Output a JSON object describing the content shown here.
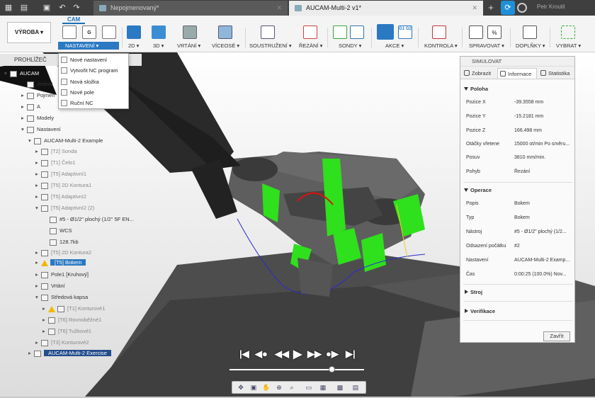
{
  "window": {
    "tab1_title": "Nepojmenovaný*",
    "tab2_title": "AUCAM-Multi-2 v1*",
    "user": "Petr Kroutil"
  },
  "toolbar": {
    "workspace_tab": "CAM",
    "workspace_button": "VÝROBA ▾",
    "groups": [
      "NASTAVENÍ ▾",
      "2D ▾",
      "3D ▾",
      "VRTÁNÍ ▾",
      "VÍCEOSÉ ▾",
      "SOUSTRUŽENÍ ▾",
      "ŘEZÁNÍ ▾",
      "SONDY ▾",
      "AKCE ▾",
      "KONTROLA ▾",
      "SPRAVOVAT ▾",
      "DOPLŇKY ▾",
      "VYBRAT ▾"
    ]
  },
  "browser": {
    "title": "PROHLÍŽEČ",
    "rows": [
      {
        "label": "AUCAM"
      },
      {
        "label": "Jednot"
      },
      {
        "label": "Pojmen"
      },
      {
        "label": "A"
      },
      {
        "label": "Modely"
      },
      {
        "label": "Nastavení"
      },
      {
        "label": "AUCAM-Multi-2 Example"
      },
      {
        "label": "[T2] Sonda"
      },
      {
        "label": "[T1] Čelo1"
      },
      {
        "label": "[T5] Adaptivní1"
      },
      {
        "label": "[T5] 2D Kontura1"
      },
      {
        "label": "[T5] Adaptivní2"
      },
      {
        "label": "[T5] Adaptivní2 (2)"
      },
      {
        "label": "#5 - Ø1/2\" plochý (1/2\" 5F EN..."
      },
      {
        "label": "WCS"
      },
      {
        "label": "128.7kb"
      },
      {
        "label": "[T5] 2D Kontura2"
      },
      {
        "label": "[T5] Bokem"
      },
      {
        "label": "Pole1 [Kruhový]"
      },
      {
        "label": "Vrtání"
      },
      {
        "label": "Středová kapsa"
      },
      {
        "label": "[T1] Konturové1"
      },
      {
        "label": "[T6] Rovnoběžné1"
      },
      {
        "label": "[T6] Tužkové1"
      },
      {
        "label": "[T3] Konturové2"
      },
      {
        "label": "AUCAM-Multi-2 Exercise"
      }
    ]
  },
  "menu": {
    "items": [
      "Nové nastavení",
      "Vytvořit NC program",
      "Nová složka",
      "Nové pole",
      "Ruční NC"
    ]
  },
  "simulate": {
    "title": "SIMULOVAT",
    "tabs": [
      "Zobrazit",
      "Informace",
      "Statistika"
    ],
    "sections": {
      "poloha": "Poloha",
      "operace": "Operace",
      "stroj": "Stroj",
      "verifikace": "Verifikace"
    },
    "poloha_rows": [
      {
        "k": "Pozice X",
        "v": "-39.3558 mm"
      },
      {
        "k": "Pozice Y",
        "v": "-15.2181 mm"
      },
      {
        "k": "Pozice Z",
        "v": "166.498 mm"
      },
      {
        "k": "Otáčky vřetene",
        "v": "15000 ot/min Po směru..."
      },
      {
        "k": "Posuv",
        "v": "3810 mm/min."
      },
      {
        "k": "Pohyb",
        "v": "Řezání"
      }
    ],
    "operace_rows": [
      {
        "k": "Popis",
        "v": "Bokem"
      },
      {
        "k": "Typ",
        "v": "Bokem"
      },
      {
        "k": "Nástroj",
        "v": "#5 - Ø1/2\" plochý (1/2..."
      },
      {
        "k": "Odsazení počátku",
        "v": "#2"
      },
      {
        "k": "Nastavení",
        "v": "AUCAM-Multi-2 Examp..."
      },
      {
        "k": "Čas",
        "v": "0:00:25 (100.0%) Nov..."
      }
    ],
    "close": "Zavřít"
  },
  "colors": {
    "accent": "#2b79c2",
    "green": "#2fe01c",
    "part_grey": "#5e5e5e"
  }
}
